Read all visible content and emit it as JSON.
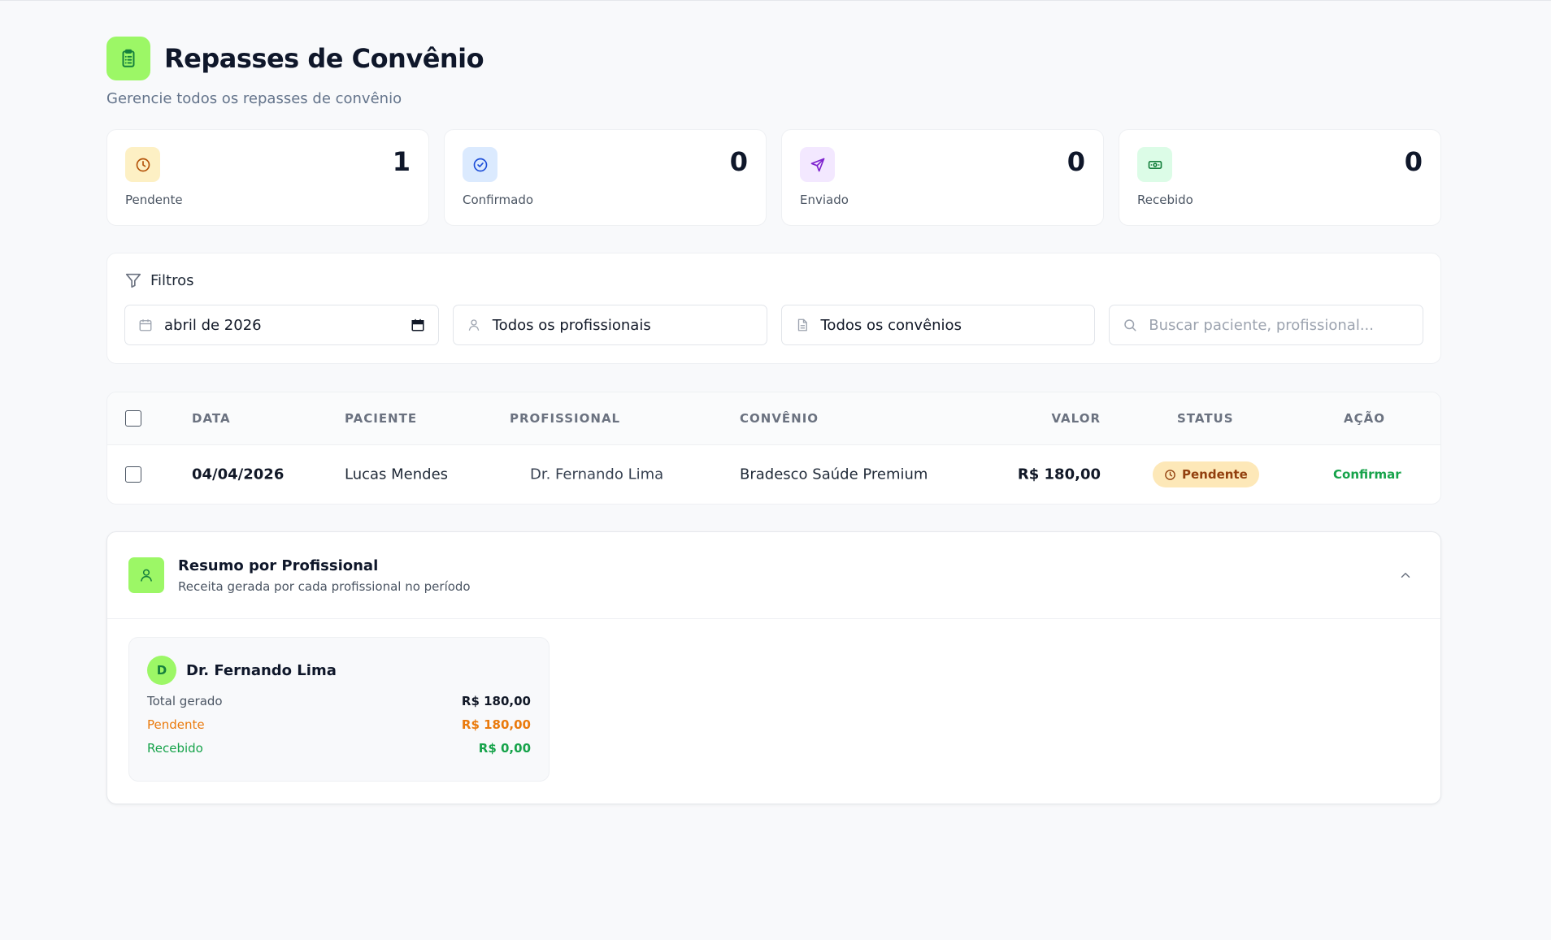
{
  "header": {
    "title": "Repasses de Convênio",
    "subtitle": "Gerencie todos os repasses de convênio"
  },
  "stats": [
    {
      "label": "Pendente",
      "value": "1",
      "icon": "clock-icon",
      "bg": "#fdf0c4",
      "color": "#b45309"
    },
    {
      "label": "Confirmado",
      "value": "0",
      "icon": "check-circle-icon",
      "bg": "#dbeafe",
      "color": "#1d4ed8"
    },
    {
      "label": "Enviado",
      "value": "0",
      "icon": "send-icon",
      "bg": "#f3e8ff",
      "color": "#7e22ce"
    },
    {
      "label": "Recebido",
      "value": "0",
      "icon": "banknote-icon",
      "bg": "#dcfce7",
      "color": "#15803d"
    }
  ],
  "filters": {
    "title": "Filtros",
    "month": "abril de 2026",
    "professional": "Todos os profissionais",
    "insurance": "Todos os convênios",
    "search_placeholder": "Buscar paciente, profissional..."
  },
  "table": {
    "columns": {
      "date": "DATA",
      "patient": "PACIENTE",
      "professional": "PROFISSIONAL",
      "insurance": "CONVÊNIO",
      "value": "VALOR",
      "status": "STATUS",
      "action": "AÇÃO"
    },
    "rows": [
      {
        "date": "04/04/2026",
        "patient": "Lucas Mendes",
        "professional": "Dr. Fernando Lima",
        "insurance": "Bradesco Saúde Premium",
        "value": "R$ 180,00",
        "status": "Pendente",
        "action": "Confirmar"
      }
    ]
  },
  "summary": {
    "title": "Resumo por Profissional",
    "subtitle": "Receita gerada por cada profissional no período",
    "professionals": [
      {
        "initial": "D",
        "name": "Dr. Fernando Lima",
        "total_label": "Total gerado",
        "total_value": "R$ 180,00",
        "pending_label": "Pendente",
        "pending_value": "R$ 180,00",
        "received_label": "Recebido",
        "received_value": "R$ 0,00"
      }
    ]
  },
  "colors": {
    "accent": "#9cf766",
    "success": "#16a34a",
    "warning": "#ea7a0c"
  }
}
